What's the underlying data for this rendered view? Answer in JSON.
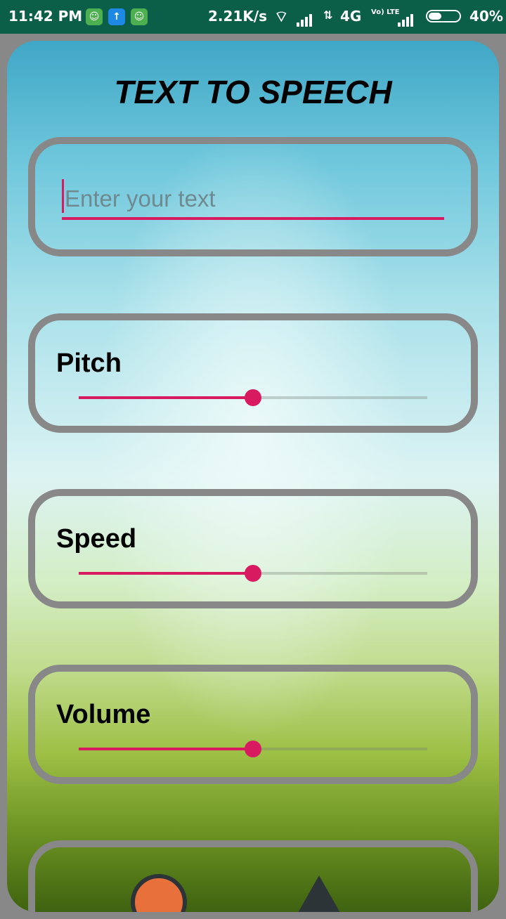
{
  "status_bar": {
    "time": "11:42 PM",
    "net_speed": "2.21K/s",
    "network_type": "4G",
    "volte_label": "Vo) LTE",
    "battery": "40%",
    "notification_icons": [
      "game-icon",
      "upload-icon",
      "game-icon"
    ]
  },
  "app": {
    "title": "TEXT TO SPEECH"
  },
  "input": {
    "placeholder": "Enter your text",
    "value": ""
  },
  "controls": {
    "pitch": {
      "label": "Pitch",
      "value": 0.5
    },
    "speed": {
      "label": "Speed",
      "value": 0.5
    },
    "volume": {
      "label": "Volume",
      "value": 0.5
    }
  },
  "buttons": {
    "speak_icon": "record-circle-icon",
    "up_icon": "caret-up-icon"
  },
  "colors": {
    "accent": "#d81b60",
    "frame": "#888888",
    "status_bar": "#0b5e48",
    "speak_button": "#e8703a"
  }
}
